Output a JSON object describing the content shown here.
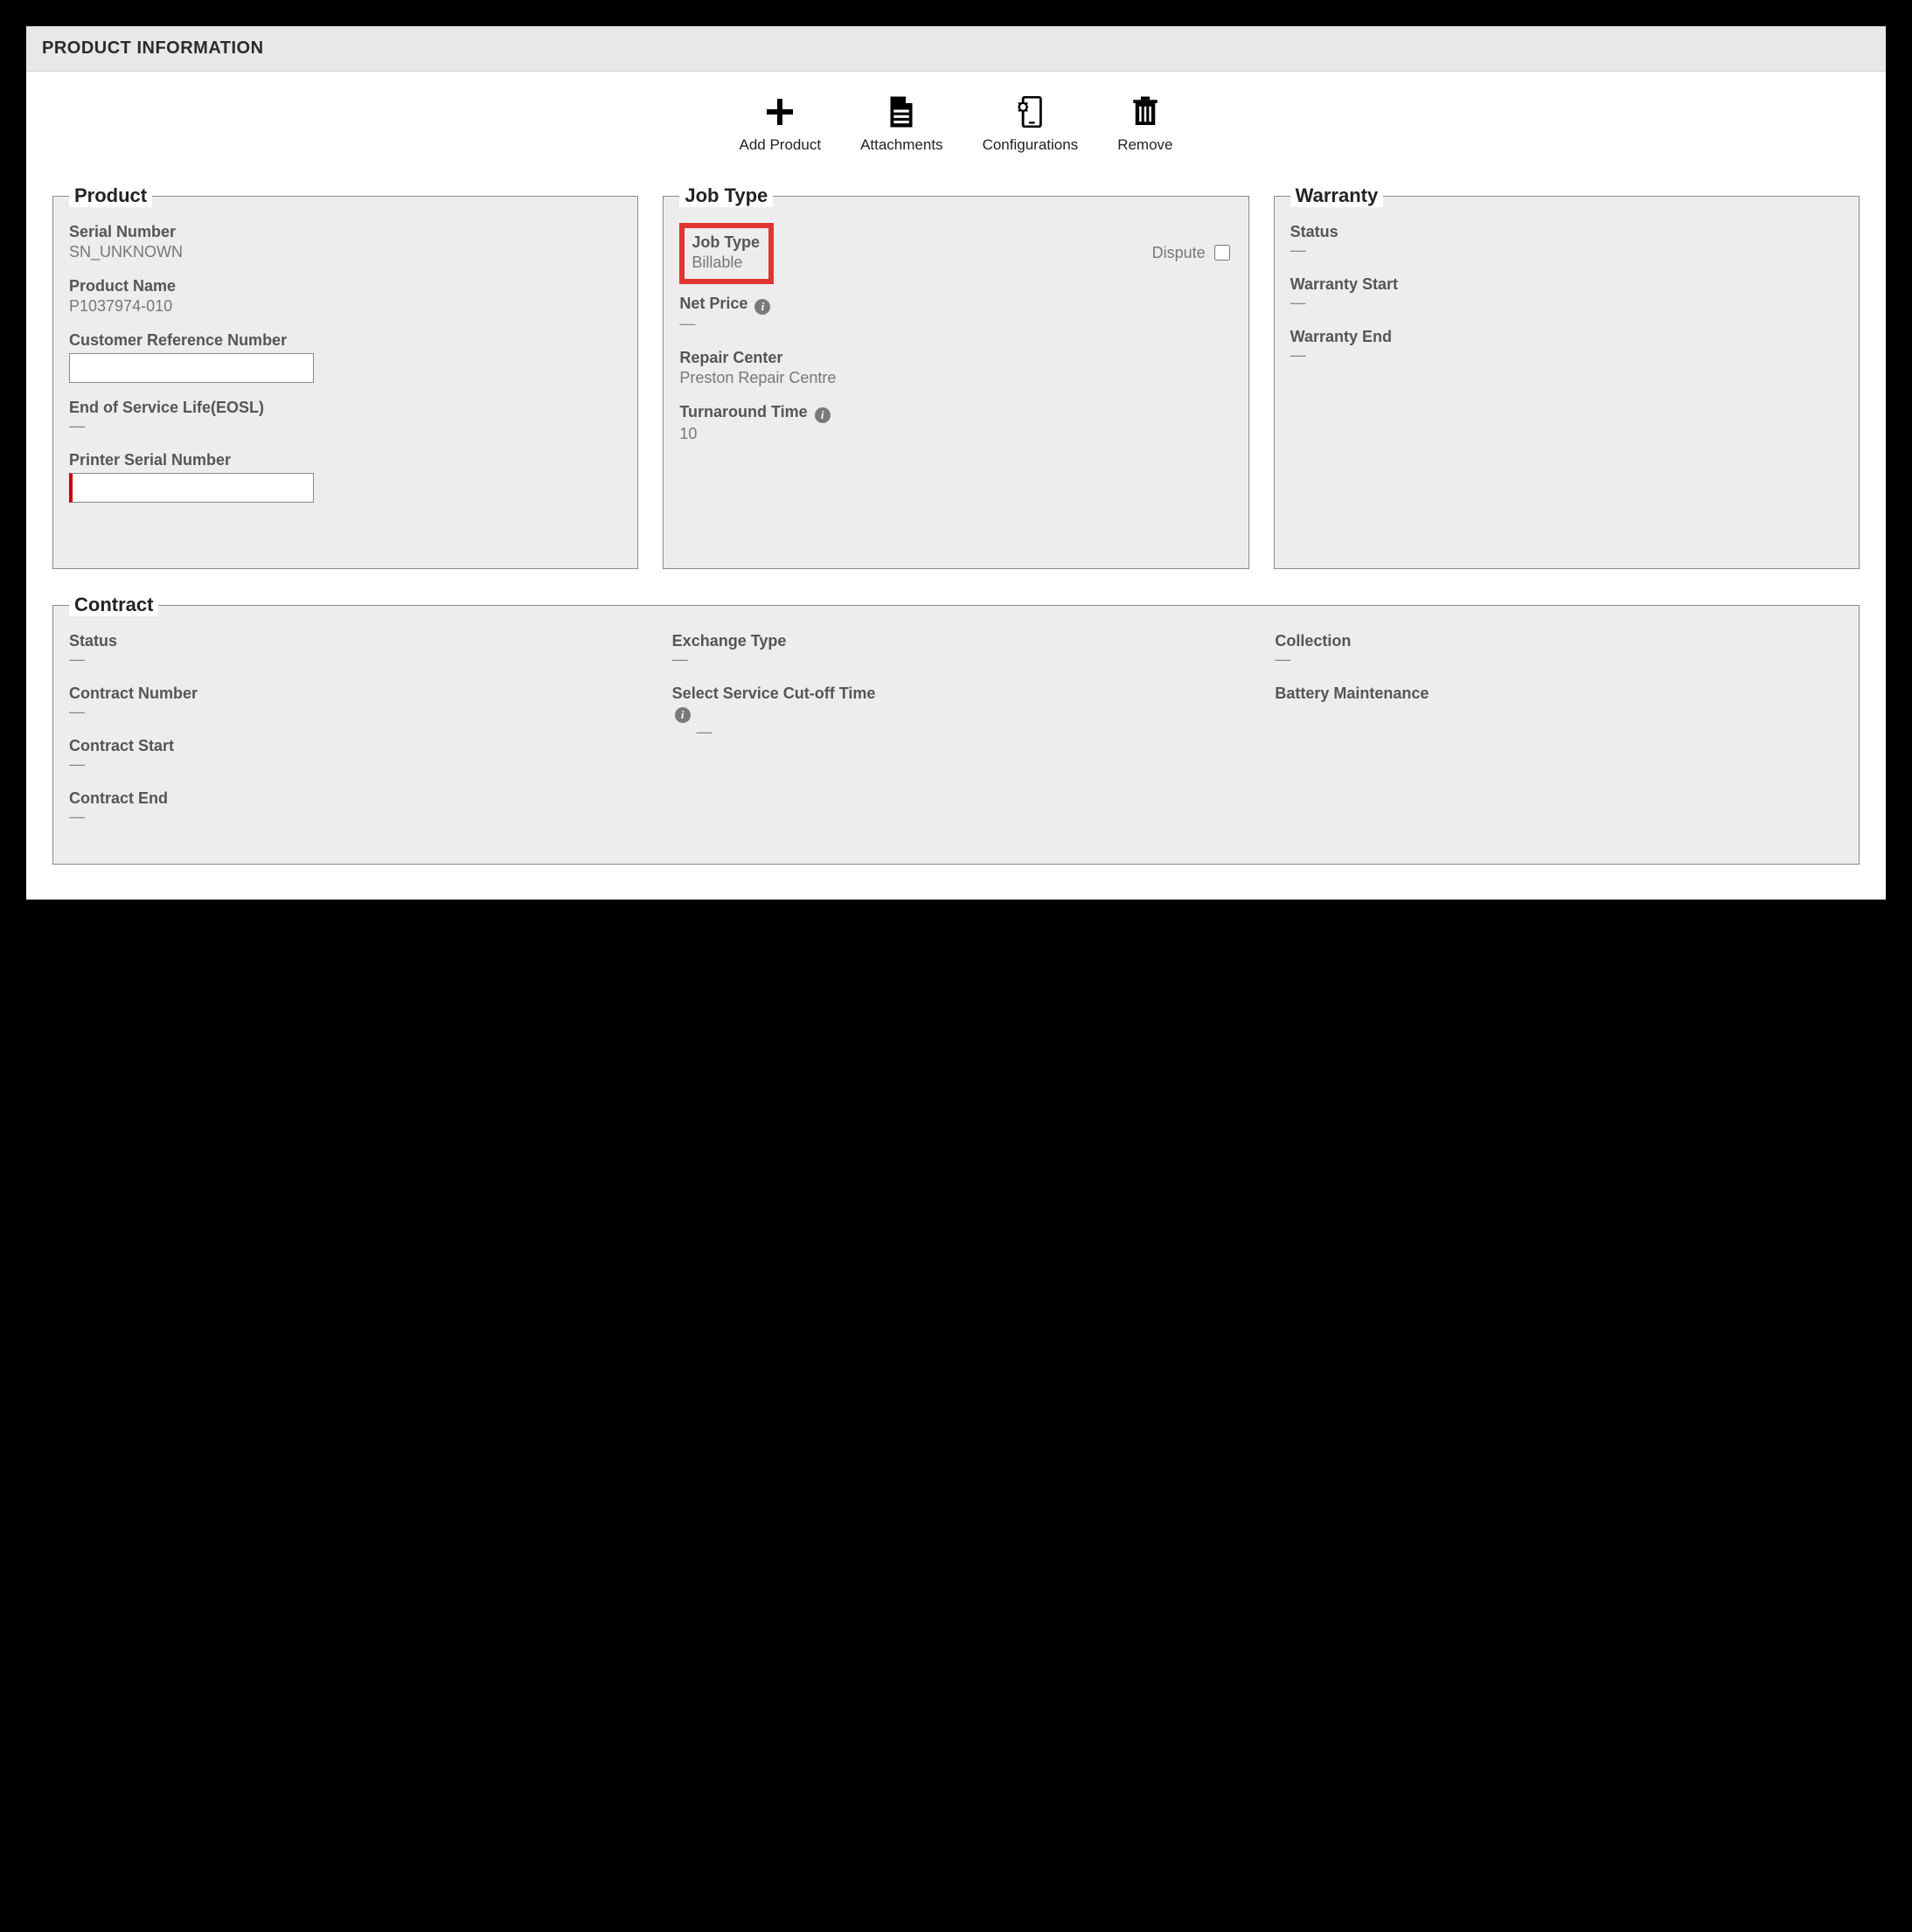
{
  "header": {
    "title": "PRODUCT INFORMATION"
  },
  "toolbar": {
    "add_product": "Add Product",
    "attachments": "Attachments",
    "configurations": "Configurations",
    "remove": "Remove"
  },
  "product": {
    "legend": "Product",
    "serial_label": "Serial Number",
    "serial_value": "SN_UNKNOWN",
    "name_label": "Product Name",
    "name_value": "P1037974-010",
    "cust_ref_label": "Customer Reference Number",
    "cust_ref_value": "",
    "eosl_label": "End of Service Life(EOSL)",
    "eosl_value": "—",
    "printer_serial_label": "Printer Serial Number",
    "printer_serial_value": ""
  },
  "jobtype": {
    "legend": "Job Type",
    "jobtype_label": "Job Type",
    "jobtype_value": "Billable",
    "dispute_label": "Dispute",
    "netprice_label": "Net Price",
    "netprice_value": "—",
    "repair_center_label": "Repair Center",
    "repair_center_value": "Preston Repair Centre",
    "turnaround_label": "Turnaround Time",
    "turnaround_value": "10"
  },
  "warranty": {
    "legend": "Warranty",
    "status_label": "Status",
    "status_value": "—",
    "start_label": "Warranty Start",
    "start_value": "—",
    "end_label": "Warranty End",
    "end_value": "—"
  },
  "contract": {
    "legend": "Contract",
    "status_label": "Status",
    "status_value": "—",
    "number_label": "Contract Number",
    "number_value": "—",
    "start_label": "Contract Start",
    "start_value": "—",
    "end_label": "Contract End",
    "end_value": "—",
    "exchange_label": "Exchange Type",
    "exchange_value": "—",
    "cutoff_label": "Select Service Cut-off Time",
    "cutoff_value": "—",
    "collection_label": "Collection",
    "collection_value": "—",
    "battery_label": "Battery Maintenance",
    "battery_value": ""
  }
}
